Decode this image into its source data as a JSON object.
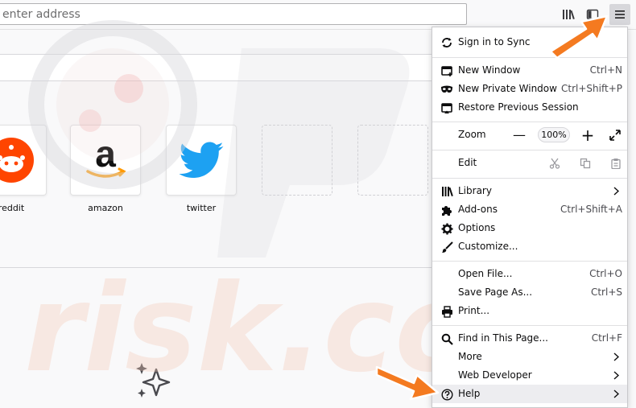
{
  "toolbar": {
    "address_placeholder": "enter address"
  },
  "top_sites": [
    {
      "label": "reddit"
    },
    {
      "label": "amazon"
    },
    {
      "label": "twitter"
    }
  ],
  "menu": {
    "sign_in": "Sign in to Sync",
    "new_window": {
      "label": "New Window",
      "shortcut": "Ctrl+N"
    },
    "new_private": {
      "label": "New Private Window",
      "shortcut": "Ctrl+Shift+P"
    },
    "restore_session": {
      "label": "Restore Previous Session"
    },
    "zoom": {
      "label": "Zoom",
      "minus": "—",
      "value": "100%",
      "plus": "+"
    },
    "edit": {
      "label": "Edit"
    },
    "library": {
      "label": "Library"
    },
    "addons": {
      "label": "Add-ons",
      "shortcut": "Ctrl+Shift+A"
    },
    "options": {
      "label": "Options"
    },
    "customize": {
      "label": "Customize..."
    },
    "open_file": {
      "label": "Open File...",
      "shortcut": "Ctrl+O"
    },
    "save_page": {
      "label": "Save Page As...",
      "shortcut": "Ctrl+S"
    },
    "print": {
      "label": "Print..."
    },
    "find": {
      "label": "Find in This Page...",
      "shortcut": "Ctrl+F"
    },
    "more": {
      "label": "More"
    },
    "web_dev": {
      "label": "Web Developer"
    },
    "help": {
      "label": "Help"
    }
  },
  "watermark": "risk.com",
  "colors": {
    "arrow": "#f47a20",
    "menu_highlight": "#ededf0",
    "twitter_blue": "#1da1f2",
    "reddit_orange": "#ff4500",
    "amazon_orange": "#ff9900"
  }
}
